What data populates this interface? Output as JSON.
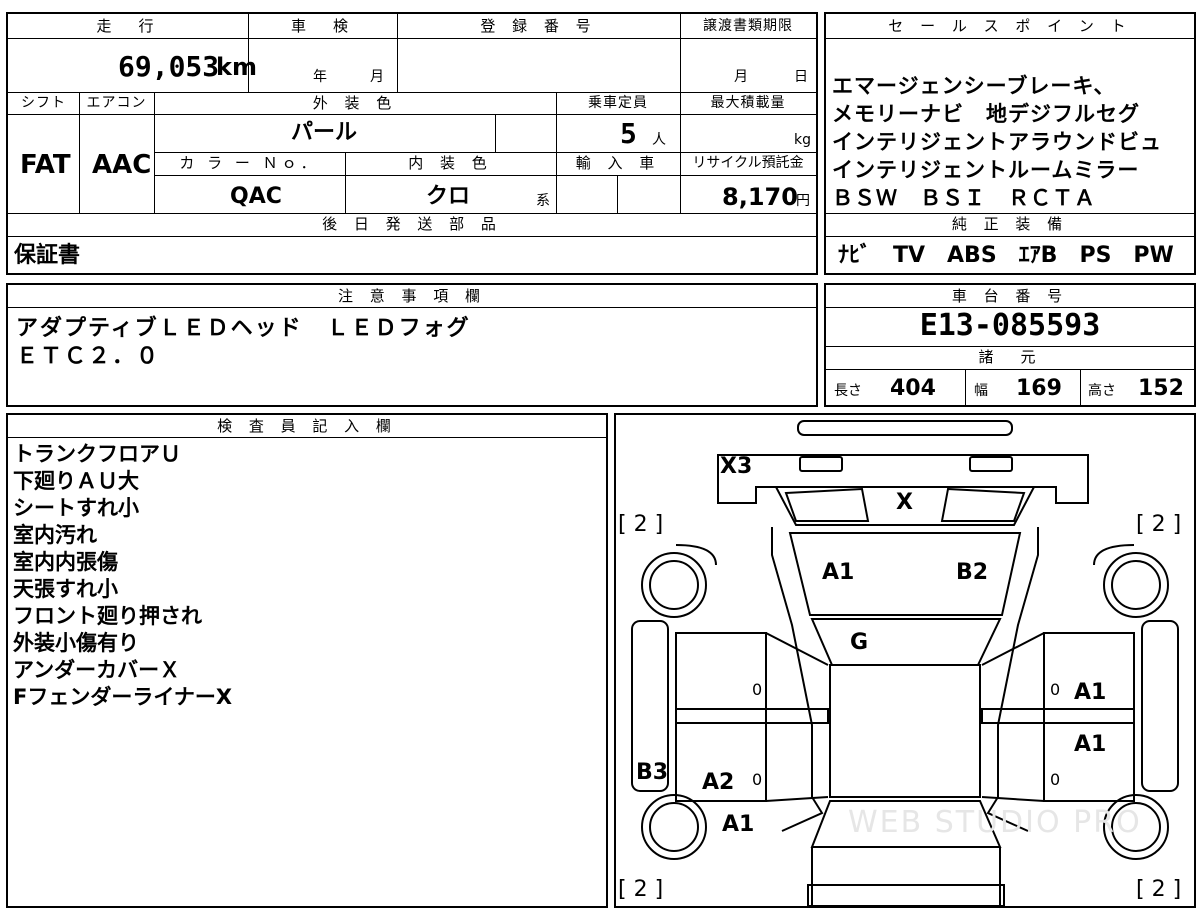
{
  "top": {
    "mileage_header": "走　行",
    "mileage_value": "69,053",
    "mileage_unit": "km",
    "inspection_header": "車　検",
    "inspection_year": "年",
    "inspection_month": "月",
    "registration_header": "登 録 番 号",
    "transfer_header": "譲渡書類期限",
    "transfer_month": "月",
    "transfer_day": "日",
    "shift_header": "シフト",
    "aircon_header": "エアコン",
    "exterior_header": "外 装 色",
    "capacity_header": "乗車定員",
    "maxload_header": "最大積載量",
    "shift_value": "FAT",
    "aircon_value": "AAC",
    "exterior_value": "パール",
    "capacity_value": "5",
    "capacity_unit": "人",
    "maxload_unit": "kg",
    "color_no_header": "カ ラ ー Ｎｏ．",
    "interior_header": "内 装 色",
    "import_header": "輸 入 車",
    "recycle_header": "リサイクル預託金",
    "color_no_value": "QAC",
    "interior_value": "クロ",
    "interior_suffix": "系",
    "recycle_value": "8,170",
    "recycle_unit": "円",
    "later_parts_header": "後 日 発 送 部 品",
    "later_parts_value": "保証書"
  },
  "sales": {
    "header": "セ ー ル ス ポ イ ン ト",
    "lines": [
      "エマージェンシーブレーキ、",
      "メモリーナビ　地デジフルセグ",
      "インテリジェントアラウンドビュ",
      "インテリジェントルームミラー",
      "ＢＳＷ　ＢＳＩ　ＲＣＴＡ"
    ],
    "equipment_header": "純 正 装 備",
    "equipment_value": "ﾅﾋﾞ　TV　ABS　ｴｱB　PS　PW"
  },
  "notes": {
    "header": "注 意 事 項 欄",
    "lines": [
      "アダプティブＬＥＤヘッド　ＬＥＤフォグ",
      "ＥＴＣ２．０"
    ]
  },
  "chassis": {
    "header": "車 台 番 号",
    "value": "E13-085593",
    "specs_header": "諸　元",
    "length_label": "長さ",
    "length_value": "404",
    "width_label": "幅",
    "width_value": "169",
    "height_label": "高さ",
    "height_value": "152"
  },
  "inspector": {
    "header": "検 査 員 記 入 欄",
    "lines": [
      "トランクフロアＵ",
      "下廻りＡＵ大",
      "シートすれ小",
      "室内汚れ",
      "室内内張傷",
      "天張すれ小",
      "フロント廻り押され",
      "外装小傷有り",
      "アンダーカバーＸ",
      "FフェンダーライナーX"
    ]
  },
  "diagram": {
    "tire_tl": "[ 2 ]",
    "tire_tr": "[ 2 ]",
    "tire_bl": "[ 2 ]",
    "tire_br": "[ 2 ]",
    "front_bumper": "X3",
    "hood": "X",
    "windshield_left": "A1",
    "windshield_right": "B2",
    "roof": "G",
    "left_sill": "B3",
    "left_rear_door": "A2",
    "left_rear_fender": "A1",
    "right_front_door": "A1",
    "right_rear_door": "A1",
    "left_front_zero": "0",
    "left_rear_zero": "0",
    "right_front_zero": "0",
    "right_rear_zero": "0",
    "watermark": "WEB STUDIO PRO"
  }
}
